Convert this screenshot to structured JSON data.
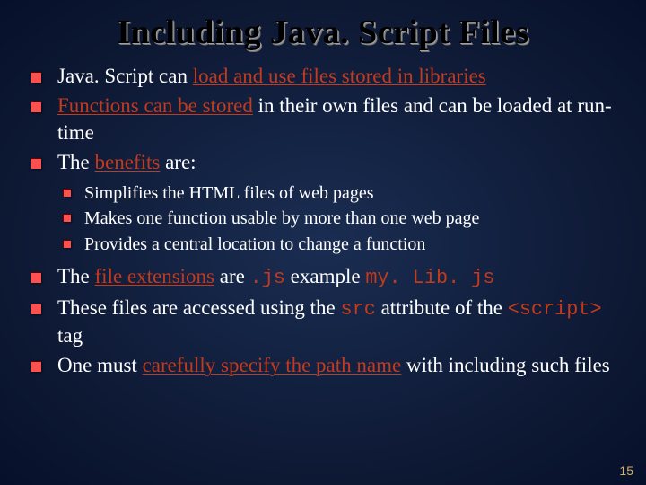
{
  "title": "Including Java. Script Files",
  "bullets": {
    "b1": {
      "pre": "Java. Script can ",
      "em": "load and use files stored in libraries",
      "post": ""
    },
    "b2": {
      "pre": "",
      "em": "Functions can be stored",
      "post": " in their own files and can be loaded at run-time"
    },
    "b3": {
      "pre": "The ",
      "em": "benefits",
      "post": " are:"
    },
    "sub": {
      "s1": "Simplifies the HTML files of web pages",
      "s2": "Makes one function usable by more than one web page",
      "s3": "Provides a central location to change a function"
    },
    "b4": {
      "pre": "The ",
      "em": "file extensions",
      "mid1": " are ",
      "code1": ".js",
      "mid2": " example ",
      "code2": "my. Lib. js"
    },
    "b5": {
      "pre": "These files are accessed using the ",
      "code1": "src",
      "mid": " attribute of the ",
      "code2": "<script>",
      "post": " tag"
    },
    "b6": {
      "pre": "One must ",
      "em": "carefully specify the path name",
      "post": " with including such files"
    }
  },
  "page_number": "15"
}
